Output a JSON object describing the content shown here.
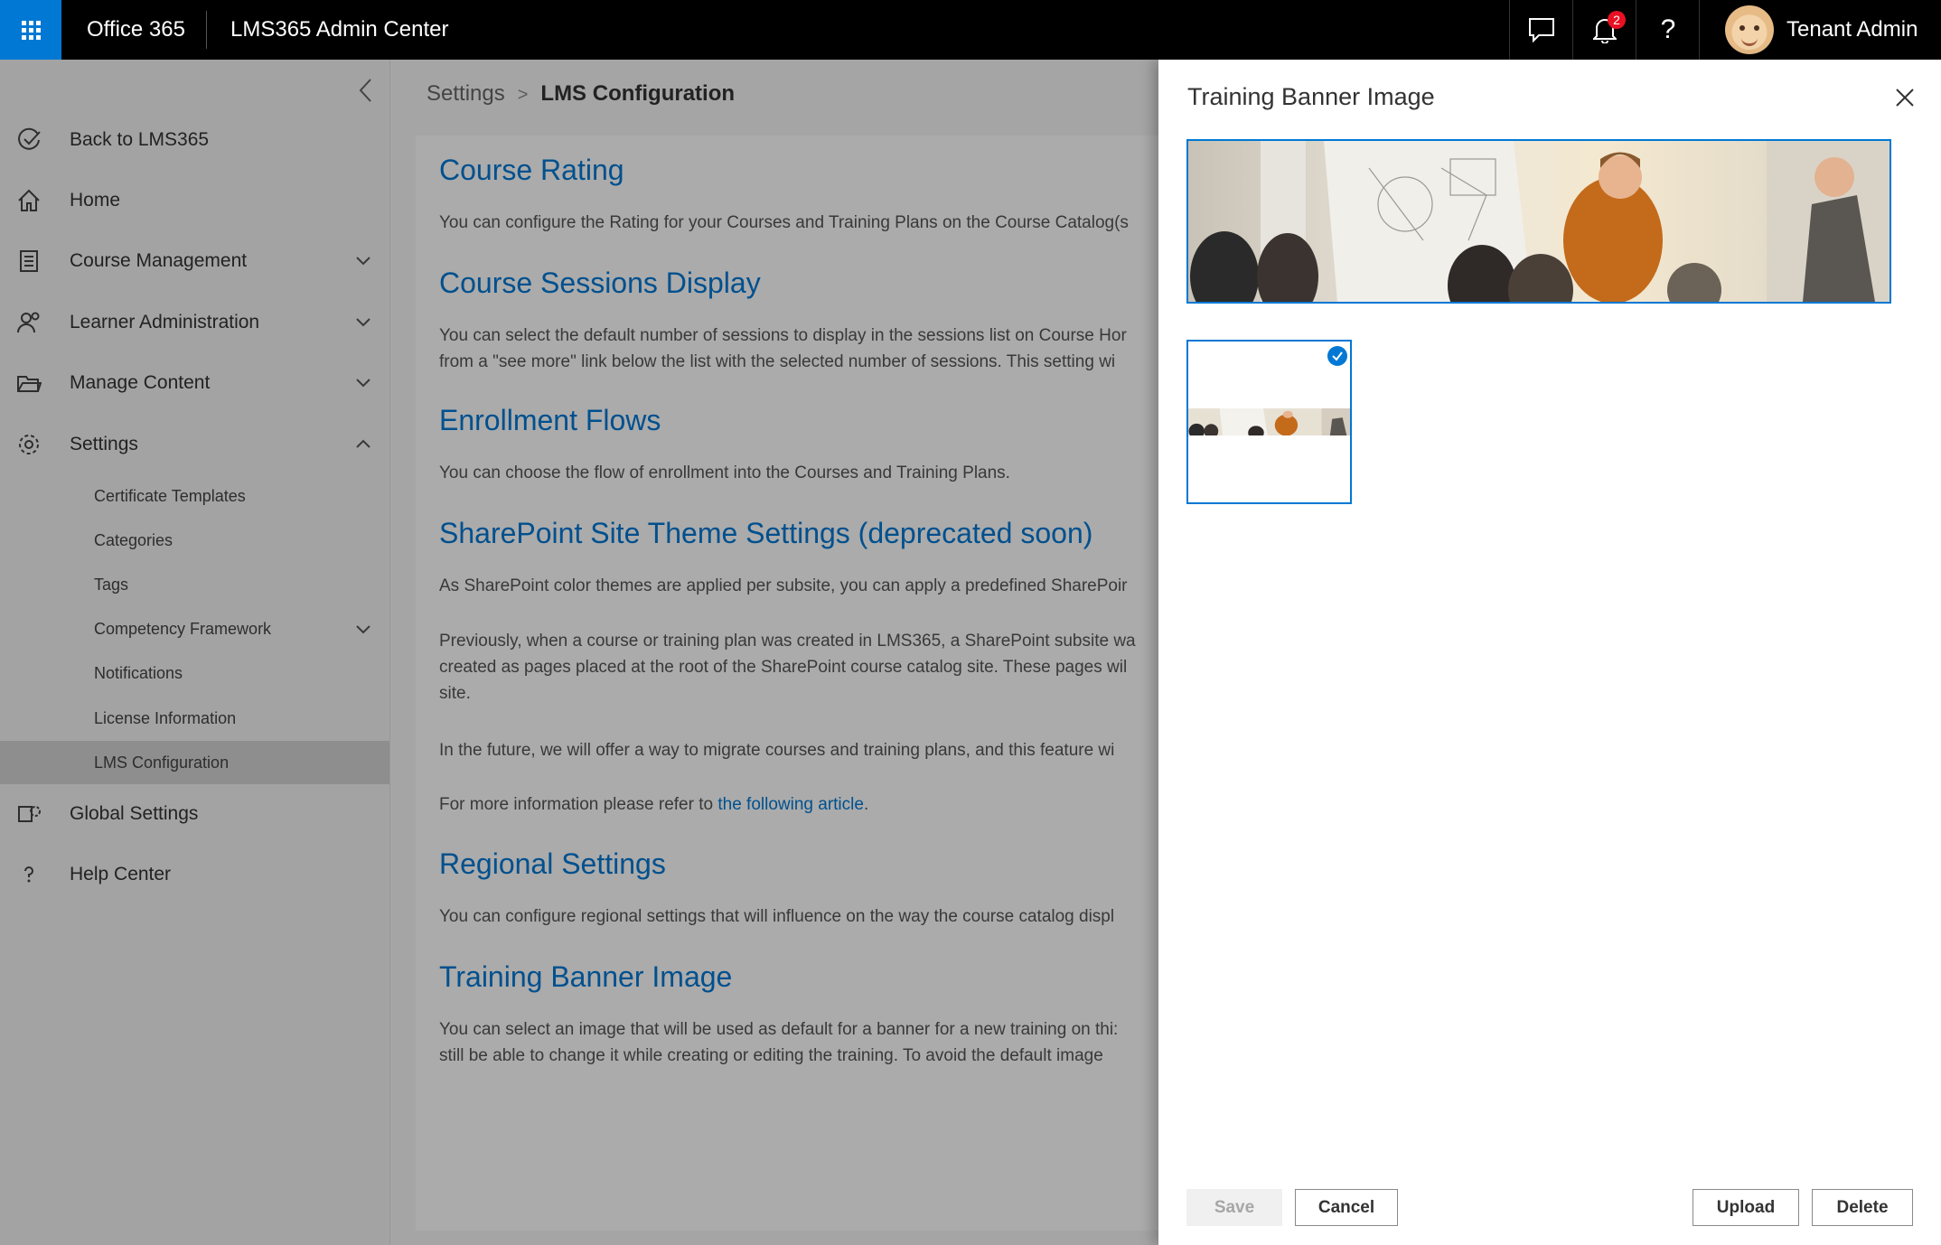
{
  "topbar": {
    "brand": "Office 365",
    "app_title": "LMS365 Admin Center",
    "notification_count": "2",
    "help_glyph": "?",
    "user_name": "Tenant Admin"
  },
  "sidebar": {
    "items": [
      {
        "label": "Back to LMS365",
        "icon": "check-circle-icon"
      },
      {
        "label": "Home",
        "icon": "home-icon"
      },
      {
        "label": "Course Management",
        "icon": "document-icon",
        "expandable": true
      },
      {
        "label": "Learner Administration",
        "icon": "people-icon",
        "expandable": true
      },
      {
        "label": "Manage Content",
        "icon": "folder-icon",
        "expandable": true
      },
      {
        "label": "Settings",
        "icon": "gear-icon",
        "expanded": true
      }
    ],
    "sub_items": [
      {
        "label": "Certificate Templates"
      },
      {
        "label": "Categories"
      },
      {
        "label": "Tags"
      },
      {
        "label": "Competency Framework",
        "expandable": true
      },
      {
        "label": "Notifications"
      },
      {
        "label": "License Information"
      },
      {
        "label": "LMS Configuration",
        "active": true
      }
    ],
    "bottom_items": [
      {
        "label": "Global Settings",
        "icon": "global-settings-icon"
      },
      {
        "label": "Help Center",
        "icon": "help-icon"
      }
    ]
  },
  "breadcrumb": {
    "parent": "Settings",
    "separator": ">",
    "current": "LMS Configuration"
  },
  "sections": {
    "course_rating": {
      "title": "Course Rating",
      "text": "You can configure the Rating for your Courses and Training Plans on the Course Catalog(s"
    },
    "sessions_display": {
      "title": "Course Sessions Display",
      "line1": "You can select the default number of sessions to display in the sessions list on Course Hor",
      "line2": "from a \"see more\" link below the list with the selected number of sessions. This setting wi"
    },
    "enrollment": {
      "title": "Enrollment Flows",
      "text": "You can choose the flow of enrollment into the Courses and Training Plans."
    },
    "sharepoint": {
      "title": "SharePoint Site Theme Settings (deprecated soon)",
      "p1": "As SharePoint color themes are applied per subsite, you can apply a predefined SharePoir",
      "p2_line1": "Previously, when a course or training plan was created in LMS365, a SharePoint subsite wa",
      "p2_line2": "created as pages placed at the root of the SharePoint course catalog site. These pages wil",
      "p2_line3": "site.",
      "p3": "In the future, we will offer a way to migrate courses and training plans, and this feature wi",
      "p4_prefix": "For more information please refer to ",
      "p4_link": "the following article",
      "p4_suffix": "."
    },
    "regional": {
      "title": "Regional Settings",
      "text": "You can configure regional settings that will influence on the way the course catalog displ"
    },
    "banner": {
      "title": "Training Banner Image",
      "line1": "You can select an image that will be used as default for a banner for a new training on thi:",
      "line2": "still be able to change it while creating or editing the training. To avoid the default image"
    }
  },
  "panel": {
    "title": "Training Banner Image",
    "buttons": {
      "save": "Save",
      "cancel": "Cancel",
      "upload": "Upload",
      "delete": "Delete"
    }
  },
  "colors": {
    "accent": "#0078d4",
    "topbar": "#000000",
    "badge": "#e81123"
  }
}
